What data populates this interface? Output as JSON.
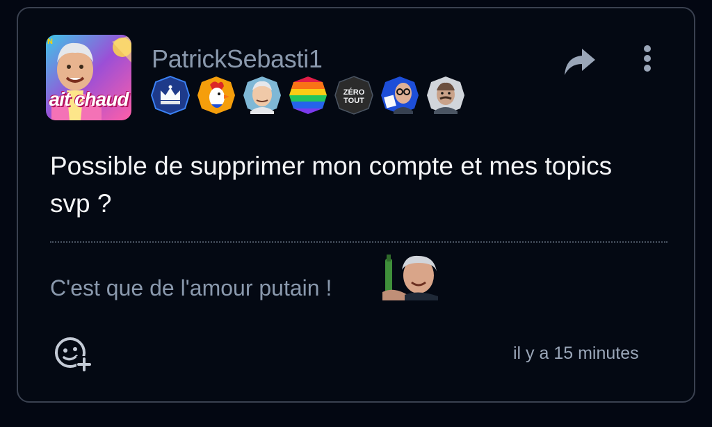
{
  "post": {
    "author": "PatrickSebasti1",
    "avatar_caption": "ait chaud",
    "avatar_corner": "N",
    "message": "Possible de supprimer mon compte et mes topics svp ?",
    "signature": "C'est que de l'amour putain !",
    "timestamp": "il y a 15 minutes"
  },
  "badges": [
    {
      "name": "crown-badge",
      "icon": "crown-icon",
      "color": "#1e3a8a"
    },
    {
      "name": "rooster-badge",
      "icon": "rooster-icon",
      "color": "#f97316"
    },
    {
      "name": "harold-badge",
      "icon": "face-icon",
      "color": "#7fb8d6"
    },
    {
      "name": "rainbow-badge",
      "icon": "rainbow-flag-icon",
      "color": "#e11d48"
    },
    {
      "name": "zero-tout-badge",
      "icon": "zero-tout-icon",
      "color": "#2b2b2b",
      "text1": "ZÉRO",
      "text2": "TOUT"
    },
    {
      "name": "man-glasses-badge",
      "icon": "face-icon",
      "color": "#1d4ed8"
    },
    {
      "name": "sketch-face-badge",
      "icon": "face-icon",
      "color": "#d1d5db"
    }
  ],
  "actions": {
    "share_icon": "share-arrow-icon",
    "more_icon": "vertical-dots-icon",
    "react_icon": "add-emoji-icon"
  },
  "colors": {
    "background": "#030712",
    "card_border": "#3a4150",
    "username": "#8a99ad",
    "message": "#f3f4f6",
    "signature": "#8a99ad"
  }
}
